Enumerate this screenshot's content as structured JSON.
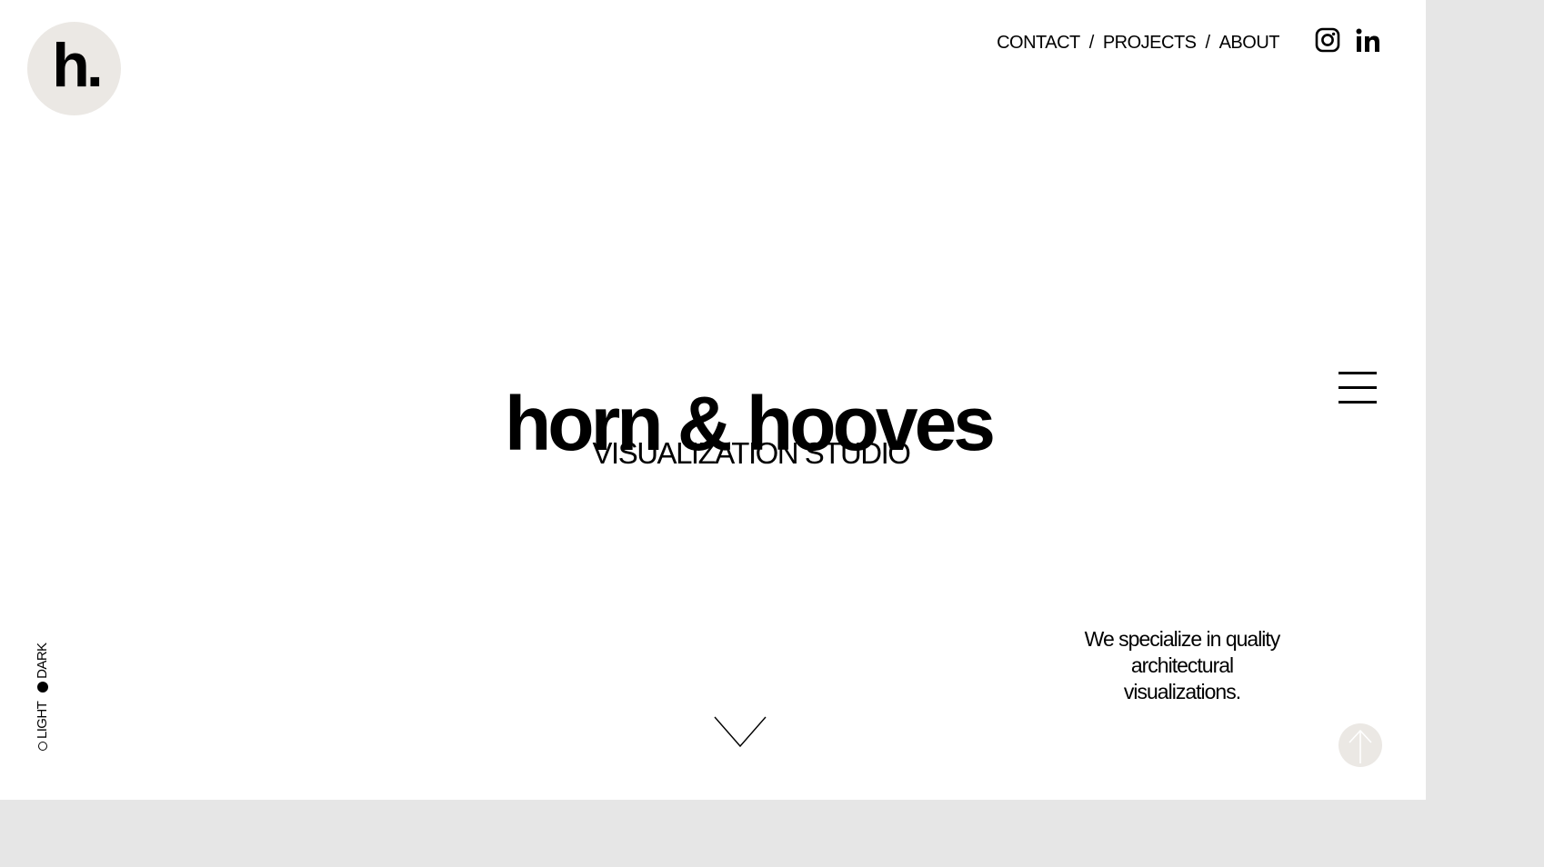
{
  "brand": {
    "logo_text": "h.",
    "title": "horn & hooves",
    "subtitle": "VISUALIZATION STUDIO"
  },
  "nav": {
    "items": [
      {
        "label": "CONTACT"
      },
      {
        "label": "PROJECTS"
      },
      {
        "label": "ABOUT"
      }
    ],
    "separator": "/"
  },
  "social": [
    "instagram-icon",
    "linkedin-icon"
  ],
  "tagline": "We specialize in quality architectural visualizations.",
  "theme_switch": {
    "options": [
      {
        "label": "LIGHT",
        "selected": false
      },
      {
        "label": "DARK",
        "selected": true
      }
    ]
  },
  "colors": {
    "background": "#ffffff",
    "logo_circle": "#ebe8e4",
    "text": "#000000",
    "back_to_top_bg": "#ebe8e4"
  }
}
